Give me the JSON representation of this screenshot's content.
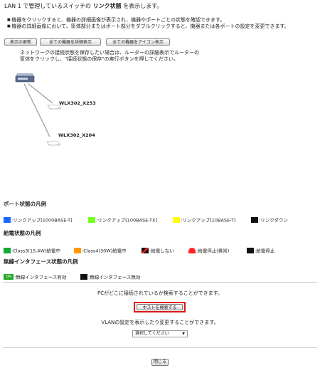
{
  "header": {
    "prefix": "LAN 1 で管理しているスイッチの",
    "highlight": "リンク状態",
    "suffix": "を表示します。"
  },
  "bullets": [
    "機器をクリックすると、機器の詳細画像が表示され、機器やポートごとの状態を確認できます。",
    "機器の詳細画像において、筐体部分またはポート部分をダブルクリックすると、機器または各ポートの設定を変更できます。"
  ],
  "toolbar": {
    "refresh": "表示の更新",
    "show_all_detail": "全ての機器を詳細表示",
    "show_all_icon": "全ての機器をアイコン表示"
  },
  "note": [
    "ネットワークの接続状態を保存したい場合は、ルーターの詳細表示でルーターの",
    "筐体をクリックし、\"接続状態の保存\"の実行ボタンを押してください。"
  ],
  "devices": [
    {
      "name": "WLX302_X253"
    },
    {
      "name": "WLX302_X204"
    }
  ],
  "port_legend": {
    "title": "ポート状態の凡例",
    "items": [
      {
        "label": ":リンクアップ[1000BASE-T]",
        "color": "#1a66ff"
      },
      {
        "label": ":リンクアップ[100BASE-TX]",
        "color": "#77ff22"
      },
      {
        "label": ":リンクアップ[10BASE-T]",
        "color": "#ffff00"
      },
      {
        "label": ":リンクダウン",
        "color": "#111111"
      }
    ]
  },
  "power_legend": {
    "title": "給電状態の凡例",
    "items": [
      {
        "label": ":Class3(15.4W)給電中",
        "color": "#11aa33"
      },
      {
        "label": ":Class4(30W)給電中",
        "color": "#ff9900"
      },
      {
        "label": ":給電しない",
        "color": "#111111"
      },
      {
        "label": ":給電停止(異常)",
        "color": "#ff2222"
      },
      {
        "label": ":給電停止",
        "color": "#111111"
      }
    ]
  },
  "wireless_legend": {
    "title": "無線インタフェース状態の凡例",
    "items": [
      {
        "label": ":無線インタフェース有効",
        "badge": "ON",
        "color": "#22aa22"
      },
      {
        "label": ":無線インタフェース無効",
        "color": "#111111"
      }
    ]
  },
  "search": {
    "text": "PCがどこに接続されているか検索することができます。",
    "button": "ホストを検索する"
  },
  "vlan": {
    "text": "VLANの設定を表示したり変更することができます。",
    "select_value": "選択してください"
  },
  "close_button": "閉じる"
}
